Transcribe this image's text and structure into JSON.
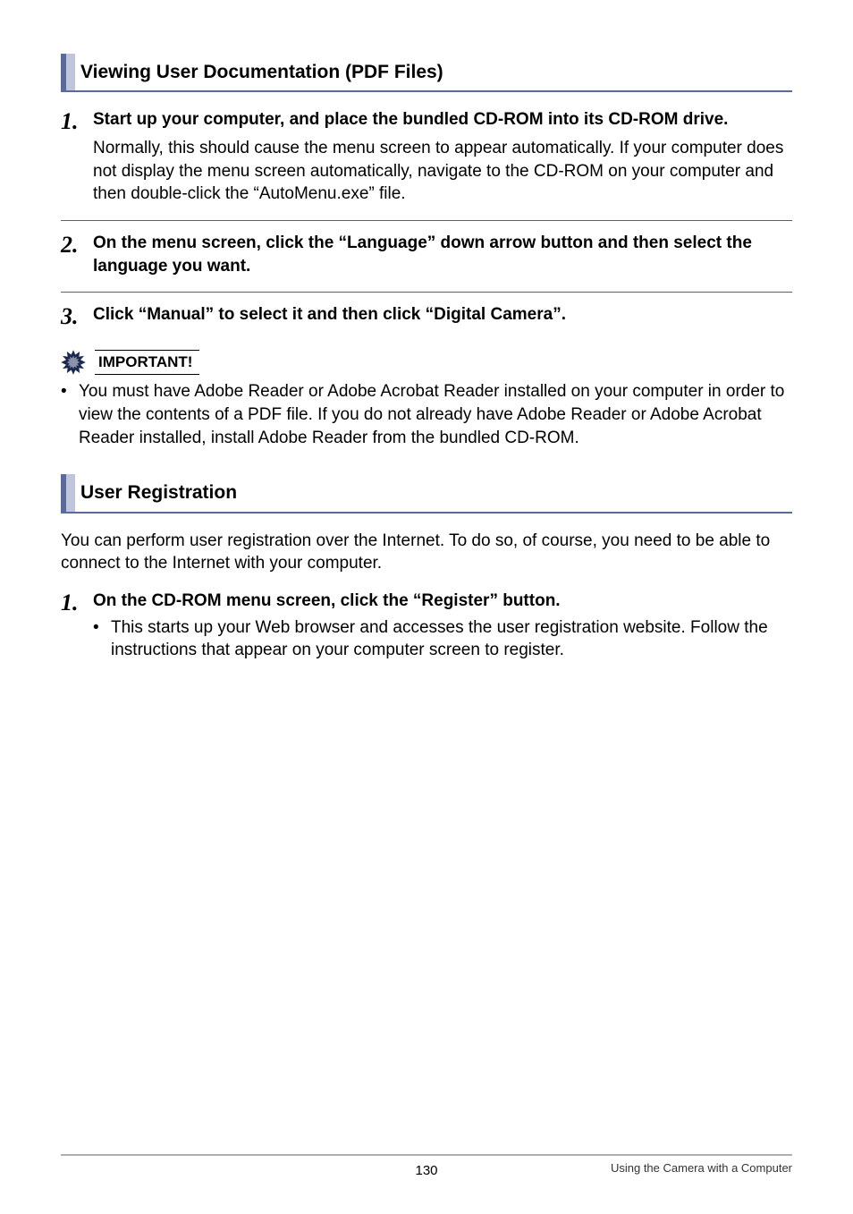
{
  "sections": {
    "viewing": {
      "title": "Viewing User Documentation (PDF Files)",
      "step1": {
        "num": "1.",
        "bold": "Start up your computer, and place the bundled CD-ROM into its CD-ROM drive.",
        "body": "Normally, this should cause the menu screen to appear automatically. If your computer does not display the menu screen automatically, navigate to the CD-ROM on your computer and then double-click the “AutoMenu.exe” file."
      },
      "step2": {
        "num": "2.",
        "bold": "On the menu screen, click the “Language” down arrow button and then select the language you want."
      },
      "step3": {
        "num": "3.",
        "bold": "Click “Manual” to select it and then click “Digital Camera”."
      }
    },
    "important": {
      "label": "IMPORTANT!",
      "bullet": "You must have Adobe Reader or Adobe Acrobat Reader installed on your computer in order to view the contents of a PDF file. If you do not already have Adobe Reader or Adobe Acrobat Reader installed, install Adobe Reader from the bundled CD-ROM."
    },
    "user_reg": {
      "title": "User Registration",
      "intro": "You can perform user registration over the Internet. To do so, of course, you need to be able to connect to the Internet with your computer.",
      "step1": {
        "num": "1.",
        "bold": "On the CD-ROM menu screen, click the “Register” button.",
        "sub": "This starts up your Web browser and accesses the user registration website. Follow the instructions that appear on your computer screen to register."
      }
    }
  },
  "footer": {
    "page": "130",
    "right": "Using the Camera with a Computer"
  }
}
